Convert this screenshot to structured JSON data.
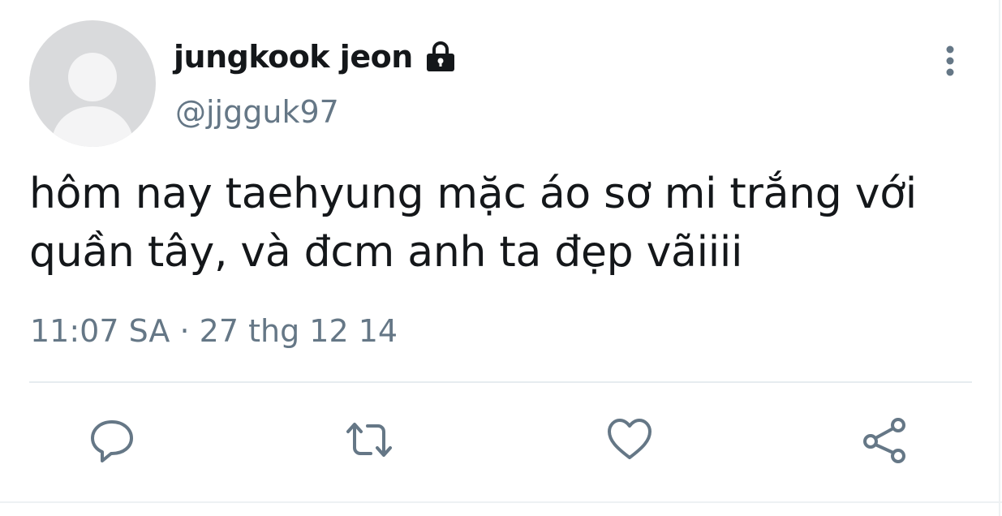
{
  "user": {
    "display_name": "jungkook jeon",
    "handle": "@jjgguk97",
    "avatar_icon": "default-avatar",
    "protected_icon": "lock-icon"
  },
  "tweet": {
    "text_line1": "hôm nay taehyung mặc áo sơ mi trắng với",
    "text_line2": "quần tây, và đcm anh ta đẹp vãiiii",
    "timestamp": "11:07 SA · 27 thg 12 14"
  },
  "actions": {
    "reply_icon": "comment-icon",
    "retweet_icon": "retweet-icon",
    "like_icon": "heart-icon",
    "share_icon": "share-icon",
    "more_icon": "more-vertical-icon"
  },
  "colors": {
    "text_primary": "#14171a",
    "text_secondary": "#657786",
    "icon": "#657786",
    "divider": "#e6ecf0",
    "avatar_bg": "#d9dadc"
  }
}
